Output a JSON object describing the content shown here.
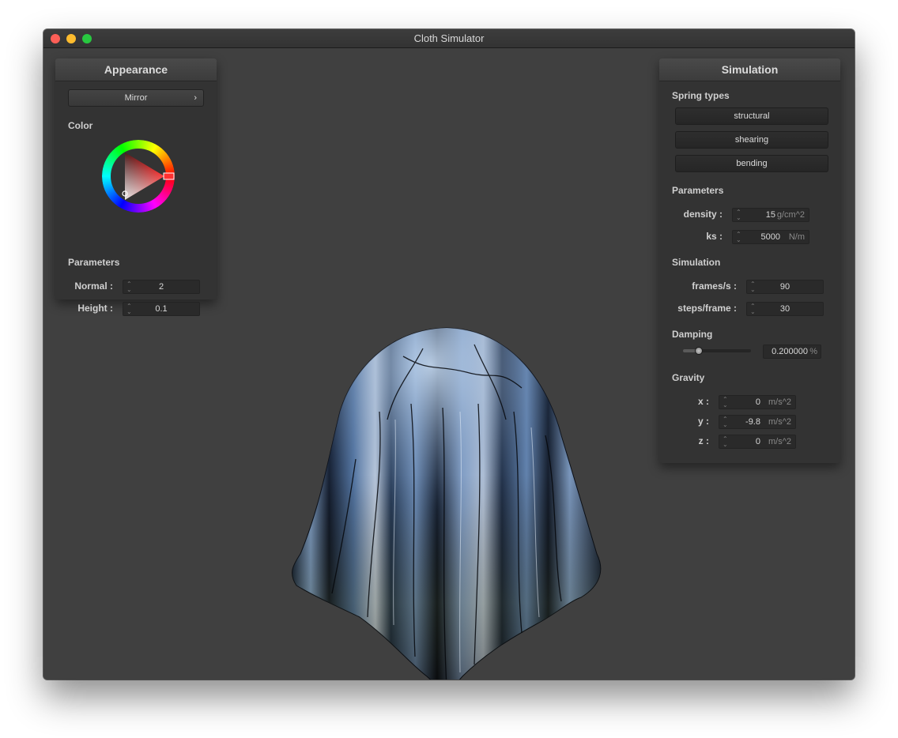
{
  "window": {
    "title": "Cloth Simulator"
  },
  "appearance": {
    "title": "Appearance",
    "shader_select": "Mirror",
    "shader_chevron": "›",
    "color_label": "Color",
    "parameters_label": "Parameters",
    "normal_label": "Normal :",
    "normal_value": "2",
    "height_label": "Height :",
    "height_value": "0.1"
  },
  "simulation": {
    "title": "Simulation",
    "spring_types_label": "Spring types",
    "spring_types": [
      "structural",
      "shearing",
      "bending"
    ],
    "parameters_label": "Parameters",
    "density_label": "density :",
    "density_value": "15",
    "density_unit": "g/cm^2",
    "ks_label": "ks :",
    "ks_value": "5000",
    "ks_unit": "N/m",
    "simulation_label": "Simulation",
    "fps_label": "frames/s :",
    "fps_value": "90",
    "steps_label": "steps/frame :",
    "steps_value": "30",
    "damping_label": "Damping",
    "damping_value": "0.200000",
    "damping_unit": "%",
    "damping_slider_fraction": 0.2,
    "gravity_label": "Gravity",
    "gx_label": "x :",
    "gx_value": "0",
    "gy_label": "y :",
    "gy_value": "-9.8",
    "gz_label": "z :",
    "gz_value": "0",
    "gravity_unit": "m/s^2"
  },
  "colors": {
    "window_bg": "#404040",
    "panel_bg": "#333333",
    "close": "#fd5f57",
    "minimize": "#febc2e",
    "maximize": "#28c840",
    "selected_color": "#ff0000"
  },
  "icons": [
    "close-icon",
    "minimize-icon",
    "maximize-icon",
    "chevron-right-icon",
    "spinner-icon",
    "color-wheel-icon"
  ]
}
